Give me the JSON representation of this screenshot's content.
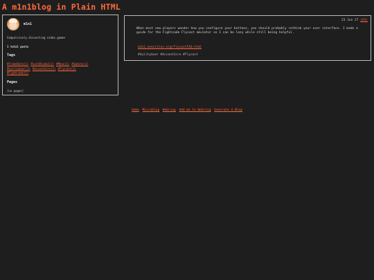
{
  "site": {
    "title": "A m1n1blog in Plain HTML"
  },
  "sidebar": {
    "username": "m1n1",
    "tagline": "Compulsively dissecting video games",
    "total_posts": "1 total posts",
    "tags_heading": "Tags",
    "tags": [
      "#FrameData(1)",
      "#LastBlade2(1)",
      "#Mbaa(1)",
      "#Samsho(1)",
      "#GuiltyGear(1)",
      "#AccentCore(1)",
      "#Flycast(1)",
      "#Fightcade(1)"
    ],
    "pages_heading": "Pages",
    "pages_value": "[no pages]"
  },
  "post": {
    "date": "23 Jun 27",
    "permalink": "(#1)",
    "body": "When most new players wonder how you configure your buttons, you should probably rethink your user interface. I made a guide for the Fightcade Flycast emulator so I can be lazy while still being helpful.",
    "link": "m1n1.neocities.org/flycastFAQ.html",
    "tags_line": "#GuiltyGear #AccentCore #Flycast"
  },
  "footer": {
    "links": [
      "Home",
      "Microblog",
      "Webring",
      "Add me to Webring",
      "Generate A Blog"
    ]
  },
  "colors": {
    "background": "#1e1e1e",
    "accent": "#ff6a3d",
    "border": "#bdbdbd",
    "text": "#d8d8d8"
  }
}
